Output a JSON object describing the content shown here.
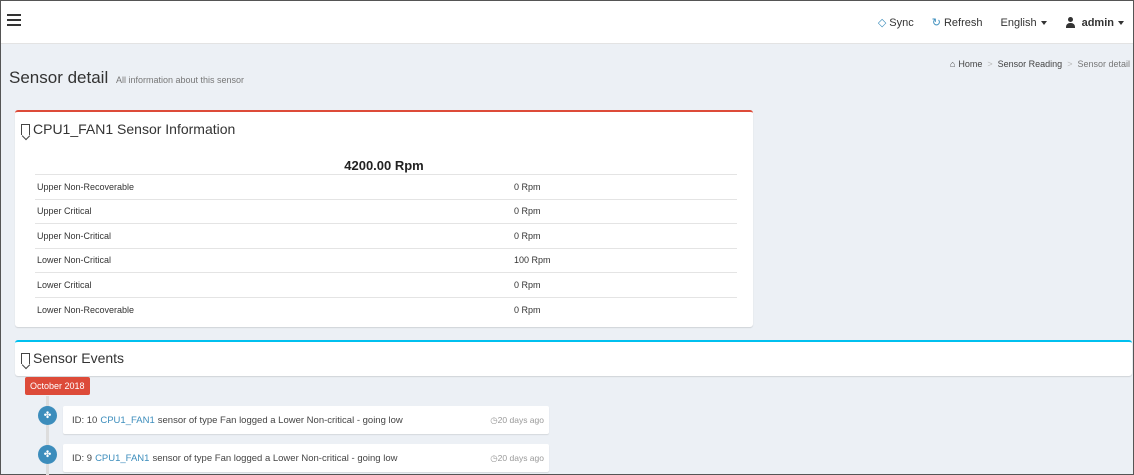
{
  "navbar": {
    "sync_label": "Sync",
    "refresh_label": "Refresh",
    "language_label": "English",
    "user_label": "admin"
  },
  "header": {
    "title": "Sensor detail",
    "subtitle": "All information about this sensor"
  },
  "breadcrumb": {
    "home": "Home",
    "sensor_reading": "Sensor Reading",
    "current": "Sensor detail"
  },
  "sensor_info": {
    "title": "CPU1_FAN1 Sensor Information",
    "reading": "4200.00 Rpm",
    "thresholds": [
      {
        "label": "Upper Non-Recoverable",
        "value": "0 Rpm"
      },
      {
        "label": "Upper Critical",
        "value": "0 Rpm"
      },
      {
        "label": "Upper Non-Critical",
        "value": "0 Rpm"
      },
      {
        "label": "Lower Non-Critical",
        "value": "100 Rpm"
      },
      {
        "label": "Lower Critical",
        "value": "0 Rpm"
      },
      {
        "label": "Lower Non-Recoverable",
        "value": "0 Rpm"
      }
    ]
  },
  "events": {
    "title": "Sensor Events",
    "month_label": "October 2018",
    "items": [
      {
        "prefix": "ID: 10",
        "sensor_link": "CPU1_FAN1",
        "message": "sensor of type Fan logged a Lower Non-critical - going low",
        "time": "20 days ago"
      },
      {
        "prefix": "ID: 9",
        "sensor_link": "CPU1_FAN1",
        "message": "sensor of type Fan logged a Lower Non-critical - going low",
        "time": "20 days ago"
      }
    ]
  },
  "colors": {
    "accent": "#3c8dbc",
    "danger": "#dd4b39",
    "info": "#00c0ef"
  }
}
